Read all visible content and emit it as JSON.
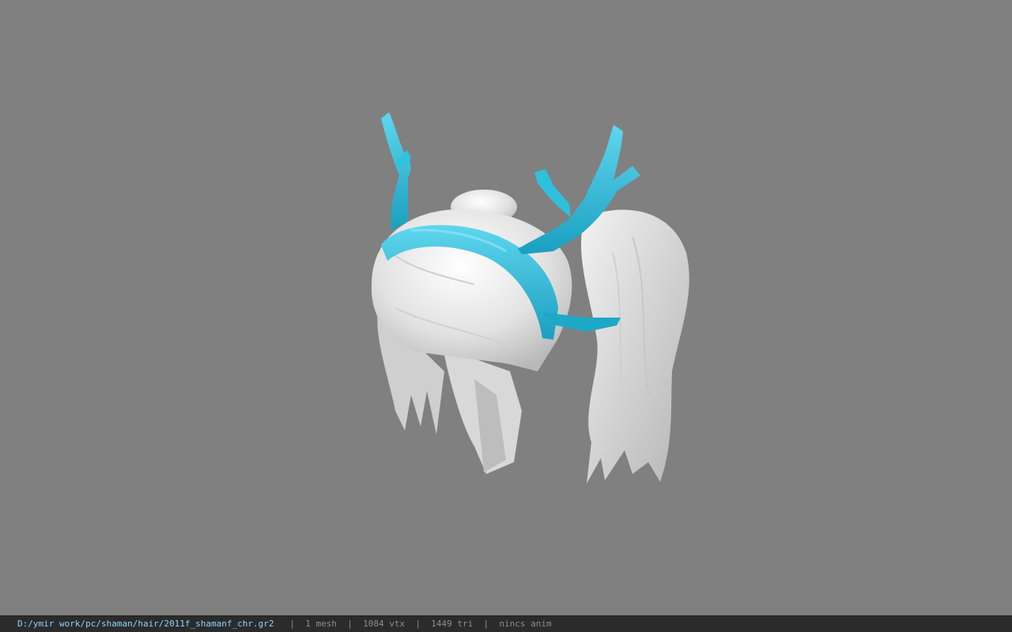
{
  "viewport": {
    "background_color": "#808080",
    "model": {
      "name": "shaman female hair with antlers",
      "hair_color": "#e8e8e8",
      "accent_color": "#29b8d6"
    }
  },
  "status_bar": {
    "file_path": "D:/ymir work/pc/shaman/hair/2011f_shamanf_chr.gr2",
    "separator": "|",
    "mesh_count": "1 mesh",
    "vertex_count": "1084 vtx",
    "triangle_count": "1449 tri",
    "anim_status": "nincs anim"
  }
}
